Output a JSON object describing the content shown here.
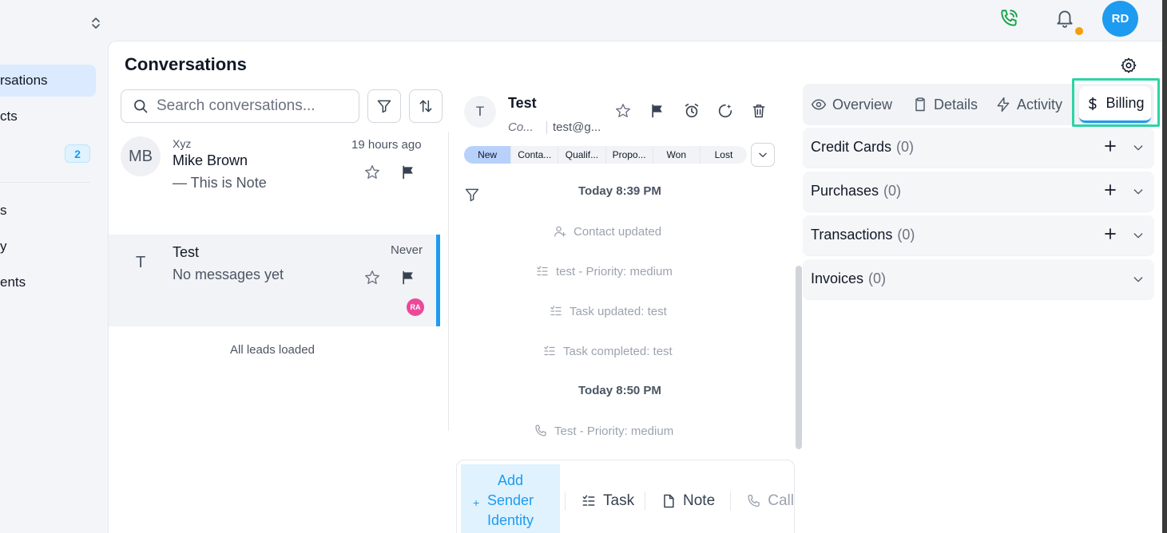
{
  "sidebar": {
    "items": [
      {
        "label": "rsations"
      },
      {
        "label": "cts"
      },
      {
        "label": "",
        "badge": "2"
      },
      {
        "label": "s"
      },
      {
        "label": "y"
      },
      {
        "label": "ents"
      }
    ]
  },
  "topbar": {
    "avatar_initials": "RD",
    "phone_icon": "phone-call-icon",
    "bell_icon": "bell-icon"
  },
  "header": {
    "title": "Conversations"
  },
  "search": {
    "placeholder": "Search conversations..."
  },
  "conversations": [
    {
      "avatar": "MB",
      "subtitle": "Xyz",
      "name": "Mike Brown",
      "preview": "—  This is Note",
      "time": "19 hours ago"
    },
    {
      "avatar": "T",
      "name": "Test",
      "preview": "No messages yet",
      "time": "Never",
      "badge": "RA"
    }
  ],
  "list_footer": "All leads loaded",
  "contact": {
    "avatar": "T",
    "name": "Test",
    "company": "Co...",
    "email": "test@g..."
  },
  "stages": [
    "New",
    "Conta...",
    "Qualif...",
    "Propo...",
    "Won",
    "Lost"
  ],
  "active_stage": "New",
  "timeline": {
    "day1": "Today 8:39 PM",
    "events1": [
      "Contact updated",
      "test  -  Priority: medium",
      "Task updated: test",
      "Task completed: test"
    ],
    "day2": "Today 8:50 PM",
    "events2": [
      "Test  -  Priority: medium"
    ]
  },
  "composer": {
    "add_sender": "Add Sender Identity",
    "task": "Task",
    "note": "Note",
    "call": "Call"
  },
  "tabs": [
    {
      "label": "Overview",
      "icon": "eye-icon"
    },
    {
      "label": "Details",
      "icon": "clipboard-icon"
    },
    {
      "label": "Activity",
      "icon": "lightning-icon"
    },
    {
      "label": "Billing",
      "icon": "dollar-icon"
    }
  ],
  "active_tab": "Billing",
  "billing_sections": [
    {
      "label": "Credit Cards",
      "count": "(0)",
      "addable": true
    },
    {
      "label": "Purchases",
      "count": "(0)",
      "addable": true
    },
    {
      "label": "Transactions",
      "count": "(0)",
      "addable": true
    },
    {
      "label": "Invoices",
      "count": "(0)",
      "addable": false
    }
  ],
  "colors": {
    "accent": "#1d9bf0",
    "highlight_box": "#2dd4a6",
    "phone": "#16a34a",
    "notification": "#f59e0b",
    "badge_ra": "#ec4899"
  }
}
